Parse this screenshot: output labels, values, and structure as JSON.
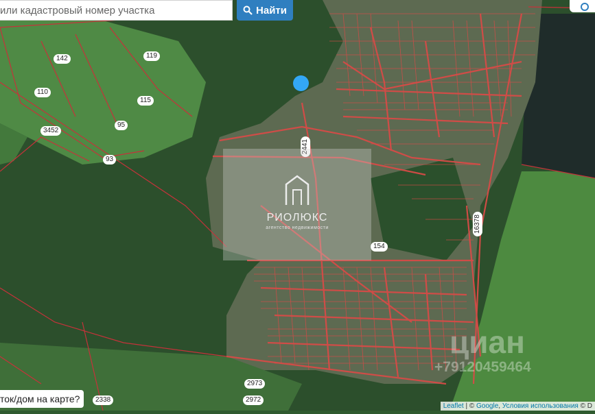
{
  "search": {
    "placeholder": "или кадастровый номер участка",
    "button_label": "Найти"
  },
  "labels": [
    {
      "text": "142"
    },
    {
      "text": "119"
    },
    {
      "text": "110"
    },
    {
      "text": "115"
    },
    {
      "text": "95"
    },
    {
      "text": "3452"
    },
    {
      "text": "93"
    },
    {
      "text": "2441"
    },
    {
      "text": "154"
    },
    {
      "text": "16378"
    },
    {
      "text": "2973"
    },
    {
      "text": "2972"
    },
    {
      "text": "2338"
    }
  ],
  "watermark": {
    "title": "РИОЛЮКС",
    "subtitle": "агентство недвижимости"
  },
  "photo_watermark": {
    "brand": "циан",
    "phone": "+79120459464"
  },
  "bottom_prompt": "ток/дом на карте?",
  "attribution": {
    "leaflet": "Leaflet",
    "separator": " | © ",
    "google": "Google",
    "terms": "Условия использования",
    "tail": " © D"
  },
  "colors": {
    "forest": "#2b502c",
    "field": "#4f8a43",
    "parcel_line": "#e0252b",
    "marker": "#33a7f5",
    "button": "#2f7fc0"
  }
}
